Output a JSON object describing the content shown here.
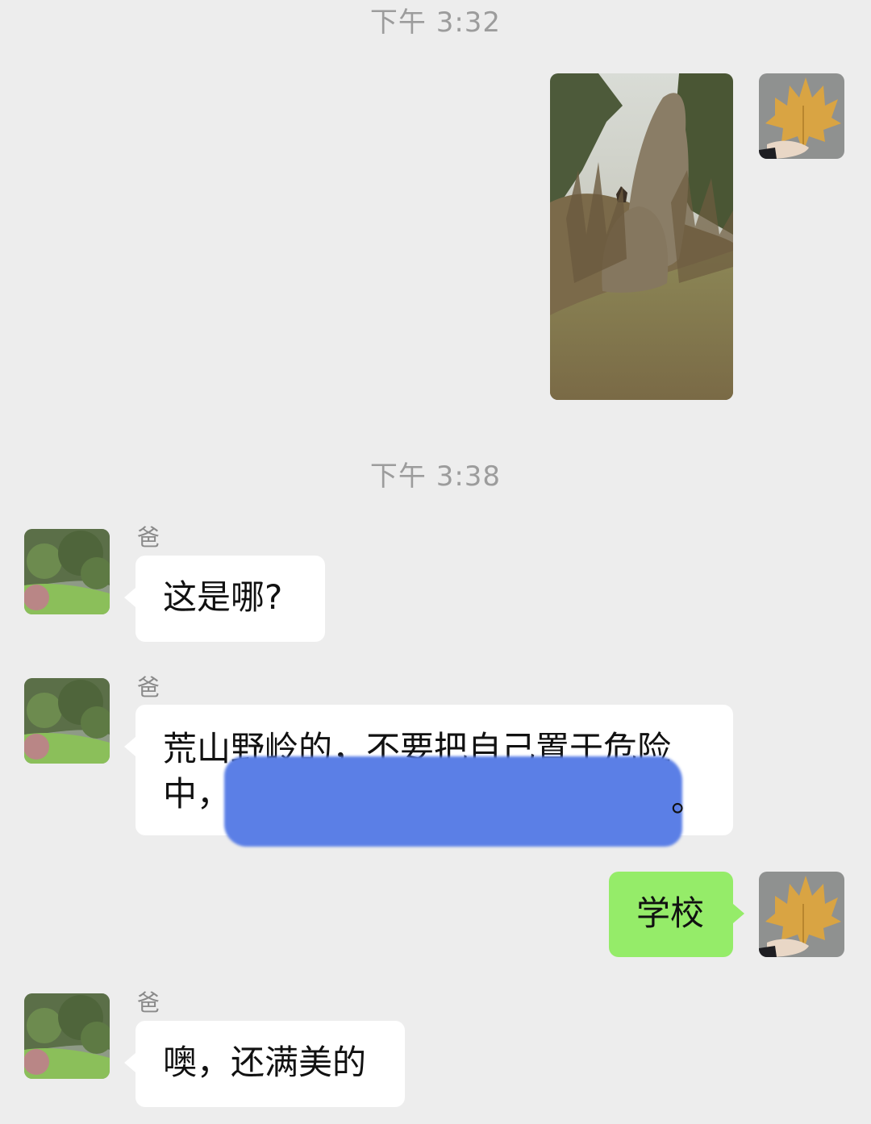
{
  "timestamps": [
    "下午 3:32",
    "下午 3:38"
  ],
  "sender_name": "爸",
  "messages": [
    {
      "side": "right",
      "type": "image",
      "content": "photo of a rock on a grassy hillside with a cat"
    },
    {
      "side": "left",
      "sender": "爸",
      "text": "这是哪?"
    },
    {
      "side": "left",
      "sender": "爸",
      "text_line1": "荒山野岭的，不要把自己置于危险",
      "text_line2": "中，",
      "text_end": "。",
      "redacted": true
    },
    {
      "side": "right",
      "text": "学校"
    },
    {
      "side": "left",
      "sender": "爸",
      "text": "噢，还满美的"
    }
  ],
  "colors": {
    "background": "#ededed",
    "bubble_left": "#ffffff",
    "bubble_right": "#95ec69",
    "timestamp": "#9c9c9c",
    "redaction": "#5b7fe6"
  },
  "icons": {
    "self_avatar": "maple-leaf-avatar-icon",
    "dad_avatar": "green-trees-avatar-icon"
  }
}
